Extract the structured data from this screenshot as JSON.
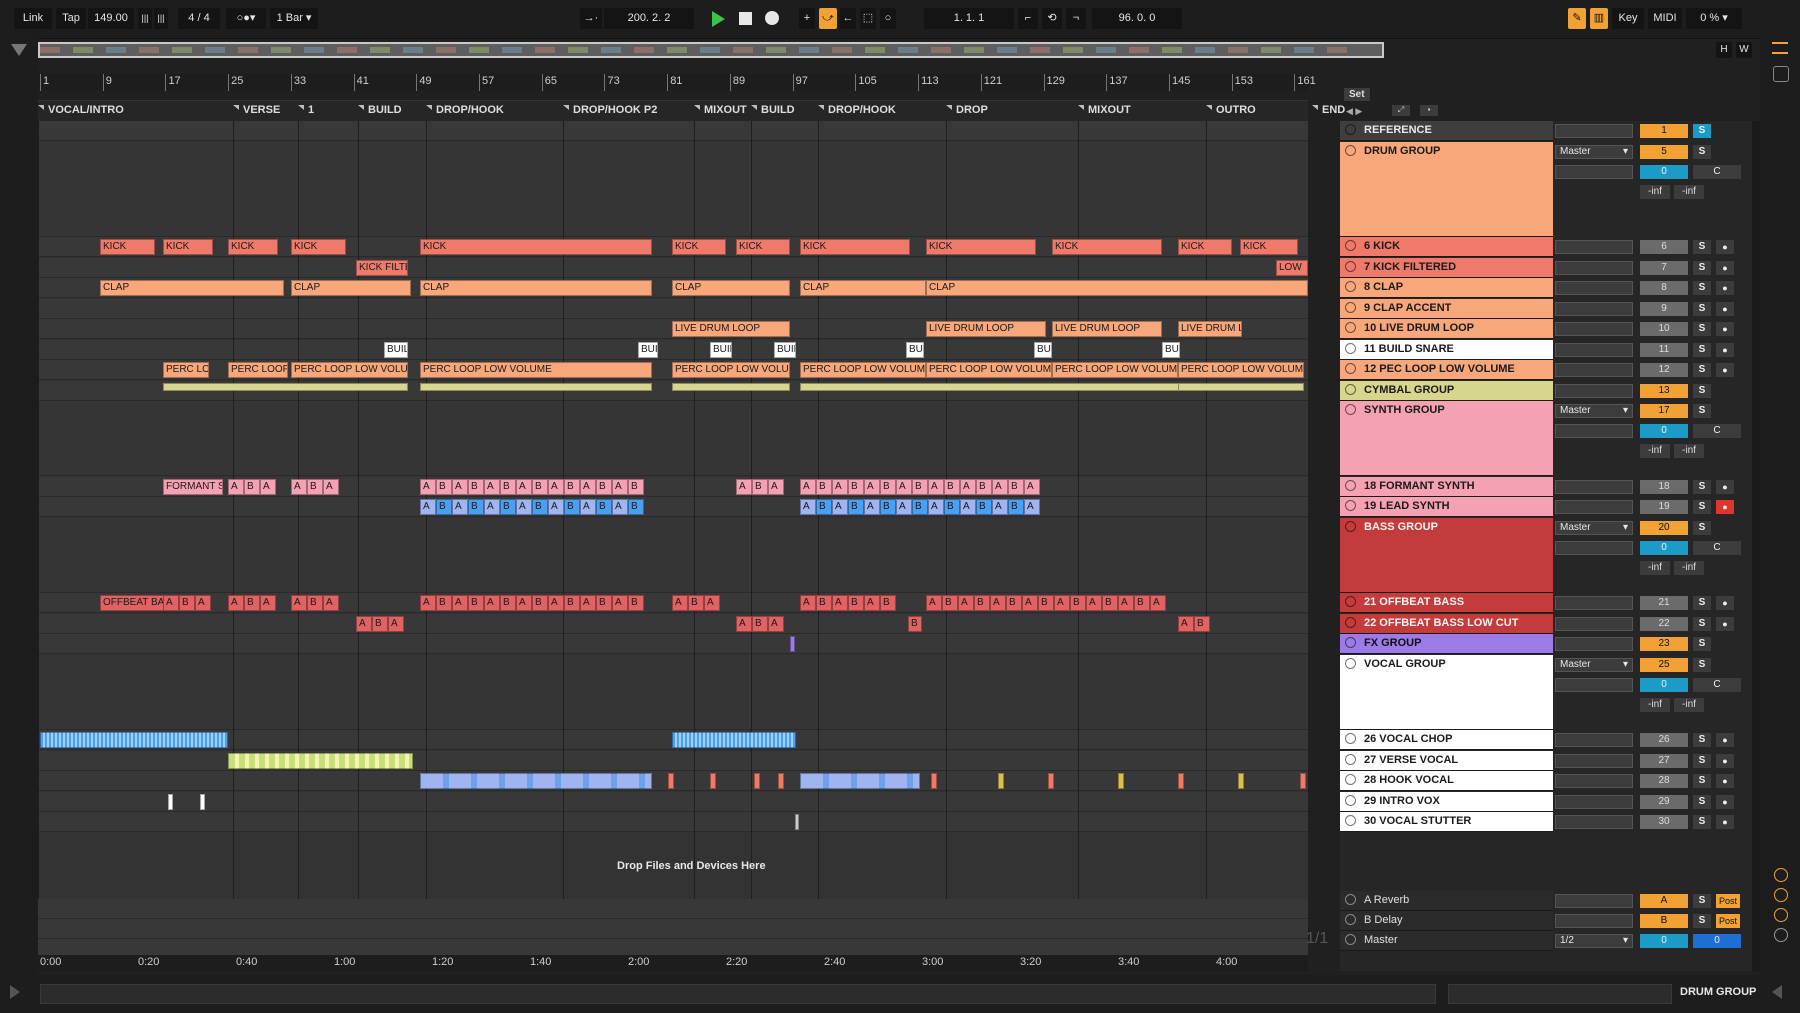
{
  "control_bar": {
    "link": "Link",
    "tap": "Tap",
    "tempo": "149.00",
    "time_sig": "4 / 4",
    "quantize": "1 Bar",
    "arrangement_position": "200.  2.  2",
    "loop_start": "1.  1.  1",
    "loop_length": "96.  0.  0",
    "key": "Key",
    "midi": "MIDI",
    "cpu": "0 %"
  },
  "ruler": {
    "bars": [
      "1",
      "9",
      "17",
      "25",
      "33",
      "41",
      "49",
      "57",
      "65",
      "73",
      "81",
      "89",
      "97",
      "105",
      "113",
      "121",
      "129",
      "137",
      "145",
      "153",
      "161"
    ]
  },
  "locators": [
    "VOCAL/INTRO",
    "VERSE",
    "1",
    "BUILD",
    "DROP/HOOK",
    "DROP/HOOK P2",
    "MIXOUT",
    "BUILD",
    "DROP/HOOK",
    "DROP",
    "MIXOUT",
    "OUTRO",
    "END"
  ],
  "time_ruler": [
    "0:00",
    "0:20",
    "0:40",
    "1:00",
    "1:20",
    "1:40",
    "2:00",
    "2:20",
    "2:40",
    "3:00",
    "3:20",
    "3:40",
    "4:00"
  ],
  "arrangement": {
    "drop_hint": "Drop Files and Devices Here",
    "page_indicator": "1/1"
  },
  "set_label": "Set",
  "clips": {
    "kick": "KICK",
    "kick_filt": "KICK FILTE",
    "clap": "CLAP",
    "live_drum": "LIVE DRUM LOOP",
    "build": "BUIL",
    "perc": "PERC LOOP LOW VOLUME",
    "perc_short": "PERC LO",
    "formant": "FORMANT S",
    "offbeat": "OFFBEAT BA",
    "a": "A",
    "b": "B",
    "low": "LOW"
  },
  "tracks": [
    {
      "name": "REFERENCE",
      "num": "1",
      "color": "#3e3e3e"
    },
    {
      "name": "DRUM GROUP",
      "num": "5",
      "color": "#f7a77a",
      "group": true
    },
    {
      "name": "6 KICK",
      "num": "6",
      "color": "#ef7a6a"
    },
    {
      "name": "7 KICK FILTERED",
      "num": "7",
      "color": "#ef7a6a"
    },
    {
      "name": "8 CLAP",
      "num": "8",
      "color": "#f7a77a"
    },
    {
      "name": "9 CLAP ACCENT",
      "num": "9",
      "color": "#f7a77a"
    },
    {
      "name": "10 LIVE DRUM LOOP",
      "num": "10",
      "color": "#f7a77a"
    },
    {
      "name": "11 BUILD SNARE",
      "num": "11",
      "color": "#ffffff"
    },
    {
      "name": "12 PEC LOOP LOW VOLUME",
      "num": "12",
      "color": "#f7a77a"
    },
    {
      "name": "CYMBAL GROUP",
      "num": "13",
      "color": "#d7d68e"
    },
    {
      "name": "SYNTH GROUP",
      "num": "17",
      "color": "#f4a1b4",
      "group": true
    },
    {
      "name": "18 FORMANT SYNTH",
      "num": "18",
      "color": "#f4a1b4"
    },
    {
      "name": "19 LEAD SYNTH",
      "num": "19",
      "color": "#f4a1b4"
    },
    {
      "name": "BASS GROUP",
      "num": "20",
      "color": "#c33b3b",
      "group": true
    },
    {
      "name": "21 OFFBEAT BASS",
      "num": "21",
      "color": "#c33b3b"
    },
    {
      "name": "22 OFFBEAT BASS LOW CUT",
      "num": "22",
      "color": "#c33b3b"
    },
    {
      "name": "FX GROUP",
      "num": "23",
      "color": "#9b7be8"
    },
    {
      "name": "VOCAL GROUP",
      "num": "25",
      "color": "#ffffff",
      "group": true
    },
    {
      "name": "26 VOCAL CHOP",
      "num": "26",
      "color": "#ffffff"
    },
    {
      "name": "27 VERSE VOCAL",
      "num": "27",
      "color": "#ffffff"
    },
    {
      "name": "28 HOOK VOCAL",
      "num": "28",
      "color": "#ffffff"
    },
    {
      "name": "29 INTRO VOX",
      "num": "29",
      "color": "#ffffff"
    },
    {
      "name": "30 VOCAL STUTTER",
      "num": "30",
      "color": "#ffffff"
    }
  ],
  "returns": [
    {
      "name": "A Reverb",
      "letter": "A",
      "post": "Post"
    },
    {
      "name": "B Delay",
      "letter": "B",
      "post": "Post"
    },
    {
      "name": "Master",
      "letter": "0",
      "routing": "1/2",
      "blue": "0"
    }
  ],
  "mixer": {
    "master_out": "Master",
    "solo": "S",
    "center": "C",
    "inf": "-inf",
    "vol_zero": "0"
  },
  "bottom": {
    "selected_track": "DRUM GROUP"
  },
  "colors": {
    "accent_orange": "#f2a234",
    "play_green": "#3fc24a",
    "arm_red": "#e0352b"
  }
}
